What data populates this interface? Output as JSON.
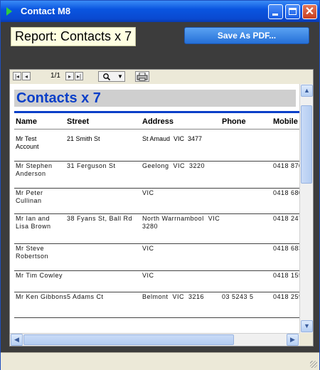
{
  "window": {
    "title": "Contact M8"
  },
  "header": {
    "report_label": "Report: Contacts x 7",
    "save_pdf_label": "Save As PDF..."
  },
  "viewer": {
    "page_indicator": "1/1",
    "report_title": "Contacts x 7",
    "columns": [
      "Name",
      "Street",
      "Address",
      "Phone",
      "Mobile"
    ],
    "rows": [
      {
        "name": [
          "Mr Test",
          "Account"
        ],
        "street": [
          "21 Smith St"
        ],
        "address": [
          "St Amaud  VIC  3477"
        ],
        "phone": [
          ""
        ],
        "mobile": [
          ""
        ]
      },
      {
        "name": [
          "Mr Stephen",
          "Anderson"
        ],
        "street": [
          "31 Ferguson St"
        ],
        "address": [
          "Geelong  VIC  3220"
        ],
        "phone": [
          ""
        ],
        "mobile": [
          "0418 870"
        ]
      },
      {
        "name": [
          "Mr Peter",
          "Cullinan"
        ],
        "street": [
          ""
        ],
        "address": [
          "VIC"
        ],
        "phone": [
          ""
        ],
        "mobile": [
          "0418 680"
        ]
      },
      {
        "name": [
          "Mr Ian and",
          "Lisa Brown"
        ],
        "street": [
          "38 Fyans St, Ball Rd"
        ],
        "address": [
          "North Warrnambool  VIC",
          "3280"
        ],
        "phone": [
          ""
        ],
        "mobile": [
          "0418 247"
        ]
      },
      {
        "name": [
          "Mr Steve",
          "Robertson"
        ],
        "street": [
          ""
        ],
        "address": [
          "VIC"
        ],
        "phone": [
          ""
        ],
        "mobile": [
          "0418 683"
        ]
      },
      {
        "name": [
          "Mr Tim Cowley",
          ""
        ],
        "street": [
          ""
        ],
        "address": [
          "VIC"
        ],
        "phone": [
          ""
        ],
        "mobile": [
          "0418 155"
        ]
      },
      {
        "name": [
          "Mr Ken Gibbons"
        ],
        "street": [
          "5 Adams Ct"
        ],
        "address": [
          "Belmont  VIC  3216"
        ],
        "phone": [
          "03 5243 5"
        ],
        "mobile": [
          "0418 259"
        ]
      }
    ]
  },
  "icons": {
    "first": "first-page-icon",
    "prev": "prev-page-icon",
    "next": "next-page-icon",
    "last": "last-page-icon",
    "zoom": "zoom-icon",
    "print": "print-icon"
  }
}
